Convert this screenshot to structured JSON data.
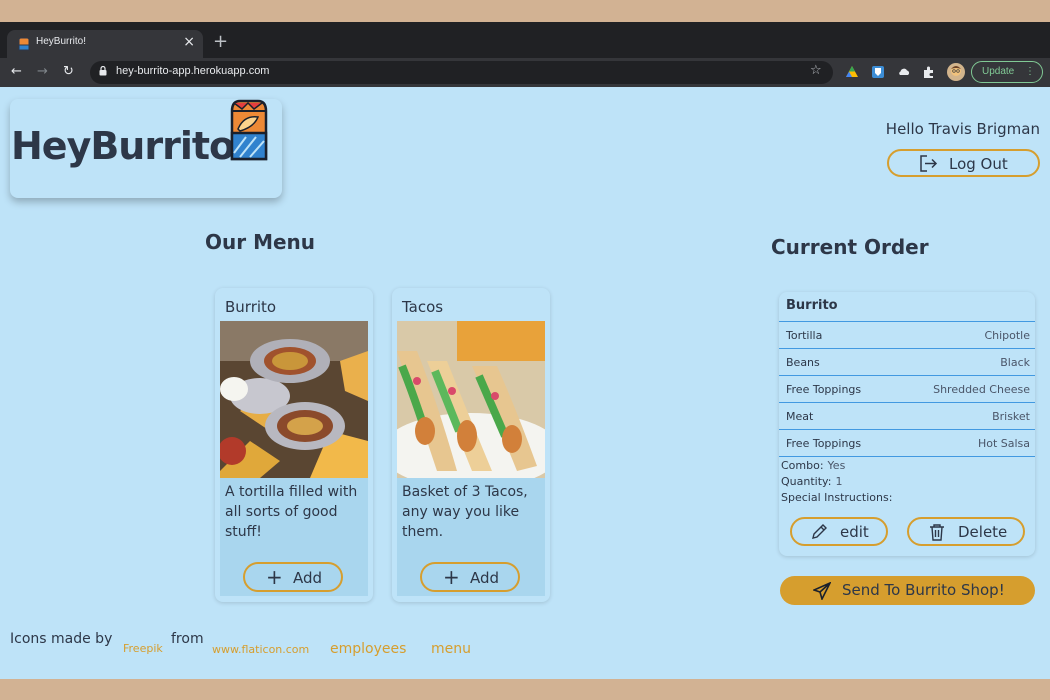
{
  "browser": {
    "tab_title": "HeyBurrito!",
    "tab_close": "×",
    "new_tab": "+",
    "url": "hey-burrito-app.herokuapp.com",
    "update_label": "Update",
    "update_menu": "⋮",
    "back": "←",
    "forward": "→",
    "reload": "↻",
    "star": "☆"
  },
  "header": {
    "logo_text": "HeyBurrito!",
    "greeting": "Hello Travis Brigman",
    "logout_label": "Log Out"
  },
  "menu": {
    "title": "Our Menu",
    "items": [
      {
        "name": "Burrito",
        "description": "A tortilla filled with all sorts of good stuff!",
        "add_label": "Add"
      },
      {
        "name": "Tacos",
        "description": "Basket of 3 Tacos, any way you like them.",
        "add_label": "Add"
      }
    ]
  },
  "order": {
    "title": "Current Order",
    "item_name": "Burrito",
    "rows": [
      {
        "key": "Tortilla",
        "value": "Chipotle"
      },
      {
        "key": "Beans",
        "value": "Black"
      },
      {
        "key": "Free Toppings",
        "value": "Shredded Cheese"
      },
      {
        "key": "Meat",
        "value": "Brisket"
      },
      {
        "key": "Free Toppings",
        "value": "Hot Salsa"
      }
    ],
    "combo_label": "Combo:",
    "combo_value": "Yes",
    "quantity_label": "Quantity:",
    "quantity_value": "1",
    "instructions_label": "Special Instructions:",
    "edit_label": "edit",
    "delete_label": "Delete",
    "send_label": "Send To Burrito Shop!"
  },
  "footer": {
    "icons_made_by": "Icons made by",
    "freepik": "Freepik",
    "from": "from",
    "flaticon": "www.flaticon.com",
    "employees": "employees",
    "menu": "menu"
  },
  "colors": {
    "page_bg": "#bee3f8",
    "accent": "#d69e2e",
    "text": "#2d3748",
    "divider": "#4299e1"
  }
}
